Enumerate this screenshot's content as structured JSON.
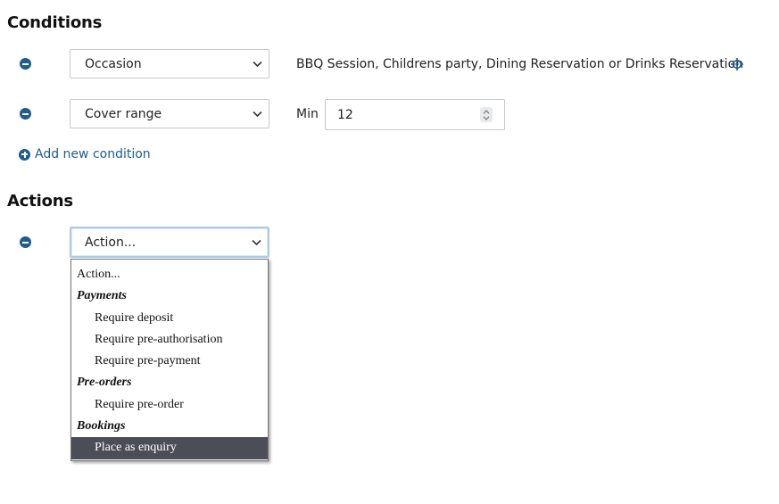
{
  "conditions": {
    "title": "Conditions",
    "rows": [
      {
        "field": "Occasion",
        "value": "BBQ Session, Childrens party, Dining Reservation or Drinks Reservation"
      },
      {
        "field": "Cover range",
        "min_label": "Min",
        "min_value": "12"
      }
    ],
    "add_label": "Add new condition"
  },
  "actions": {
    "title": "Actions",
    "select_value": "Action...",
    "dropdown": {
      "placeholder": "Action...",
      "groups": [
        {
          "label": "Payments",
          "options": [
            "Require deposit",
            "Require pre-authorisation",
            "Require pre-payment"
          ]
        },
        {
          "label": "Pre-orders",
          "options": [
            "Require pre-order"
          ]
        },
        {
          "label": "Bookings",
          "options": [
            "Place as enquiry"
          ]
        }
      ],
      "highlighted": "Place as enquiry"
    }
  },
  "icons": {
    "remove": "minus-circle-icon",
    "add": "plus-circle-icon",
    "chevron": "chevron-down-icon",
    "target": "crosshair-icon",
    "spinner": "stepper-icon"
  },
  "colors": {
    "accent": "#1f5d8c",
    "highlight": "#4b4e56",
    "focus_border": "#a9cbe8"
  }
}
